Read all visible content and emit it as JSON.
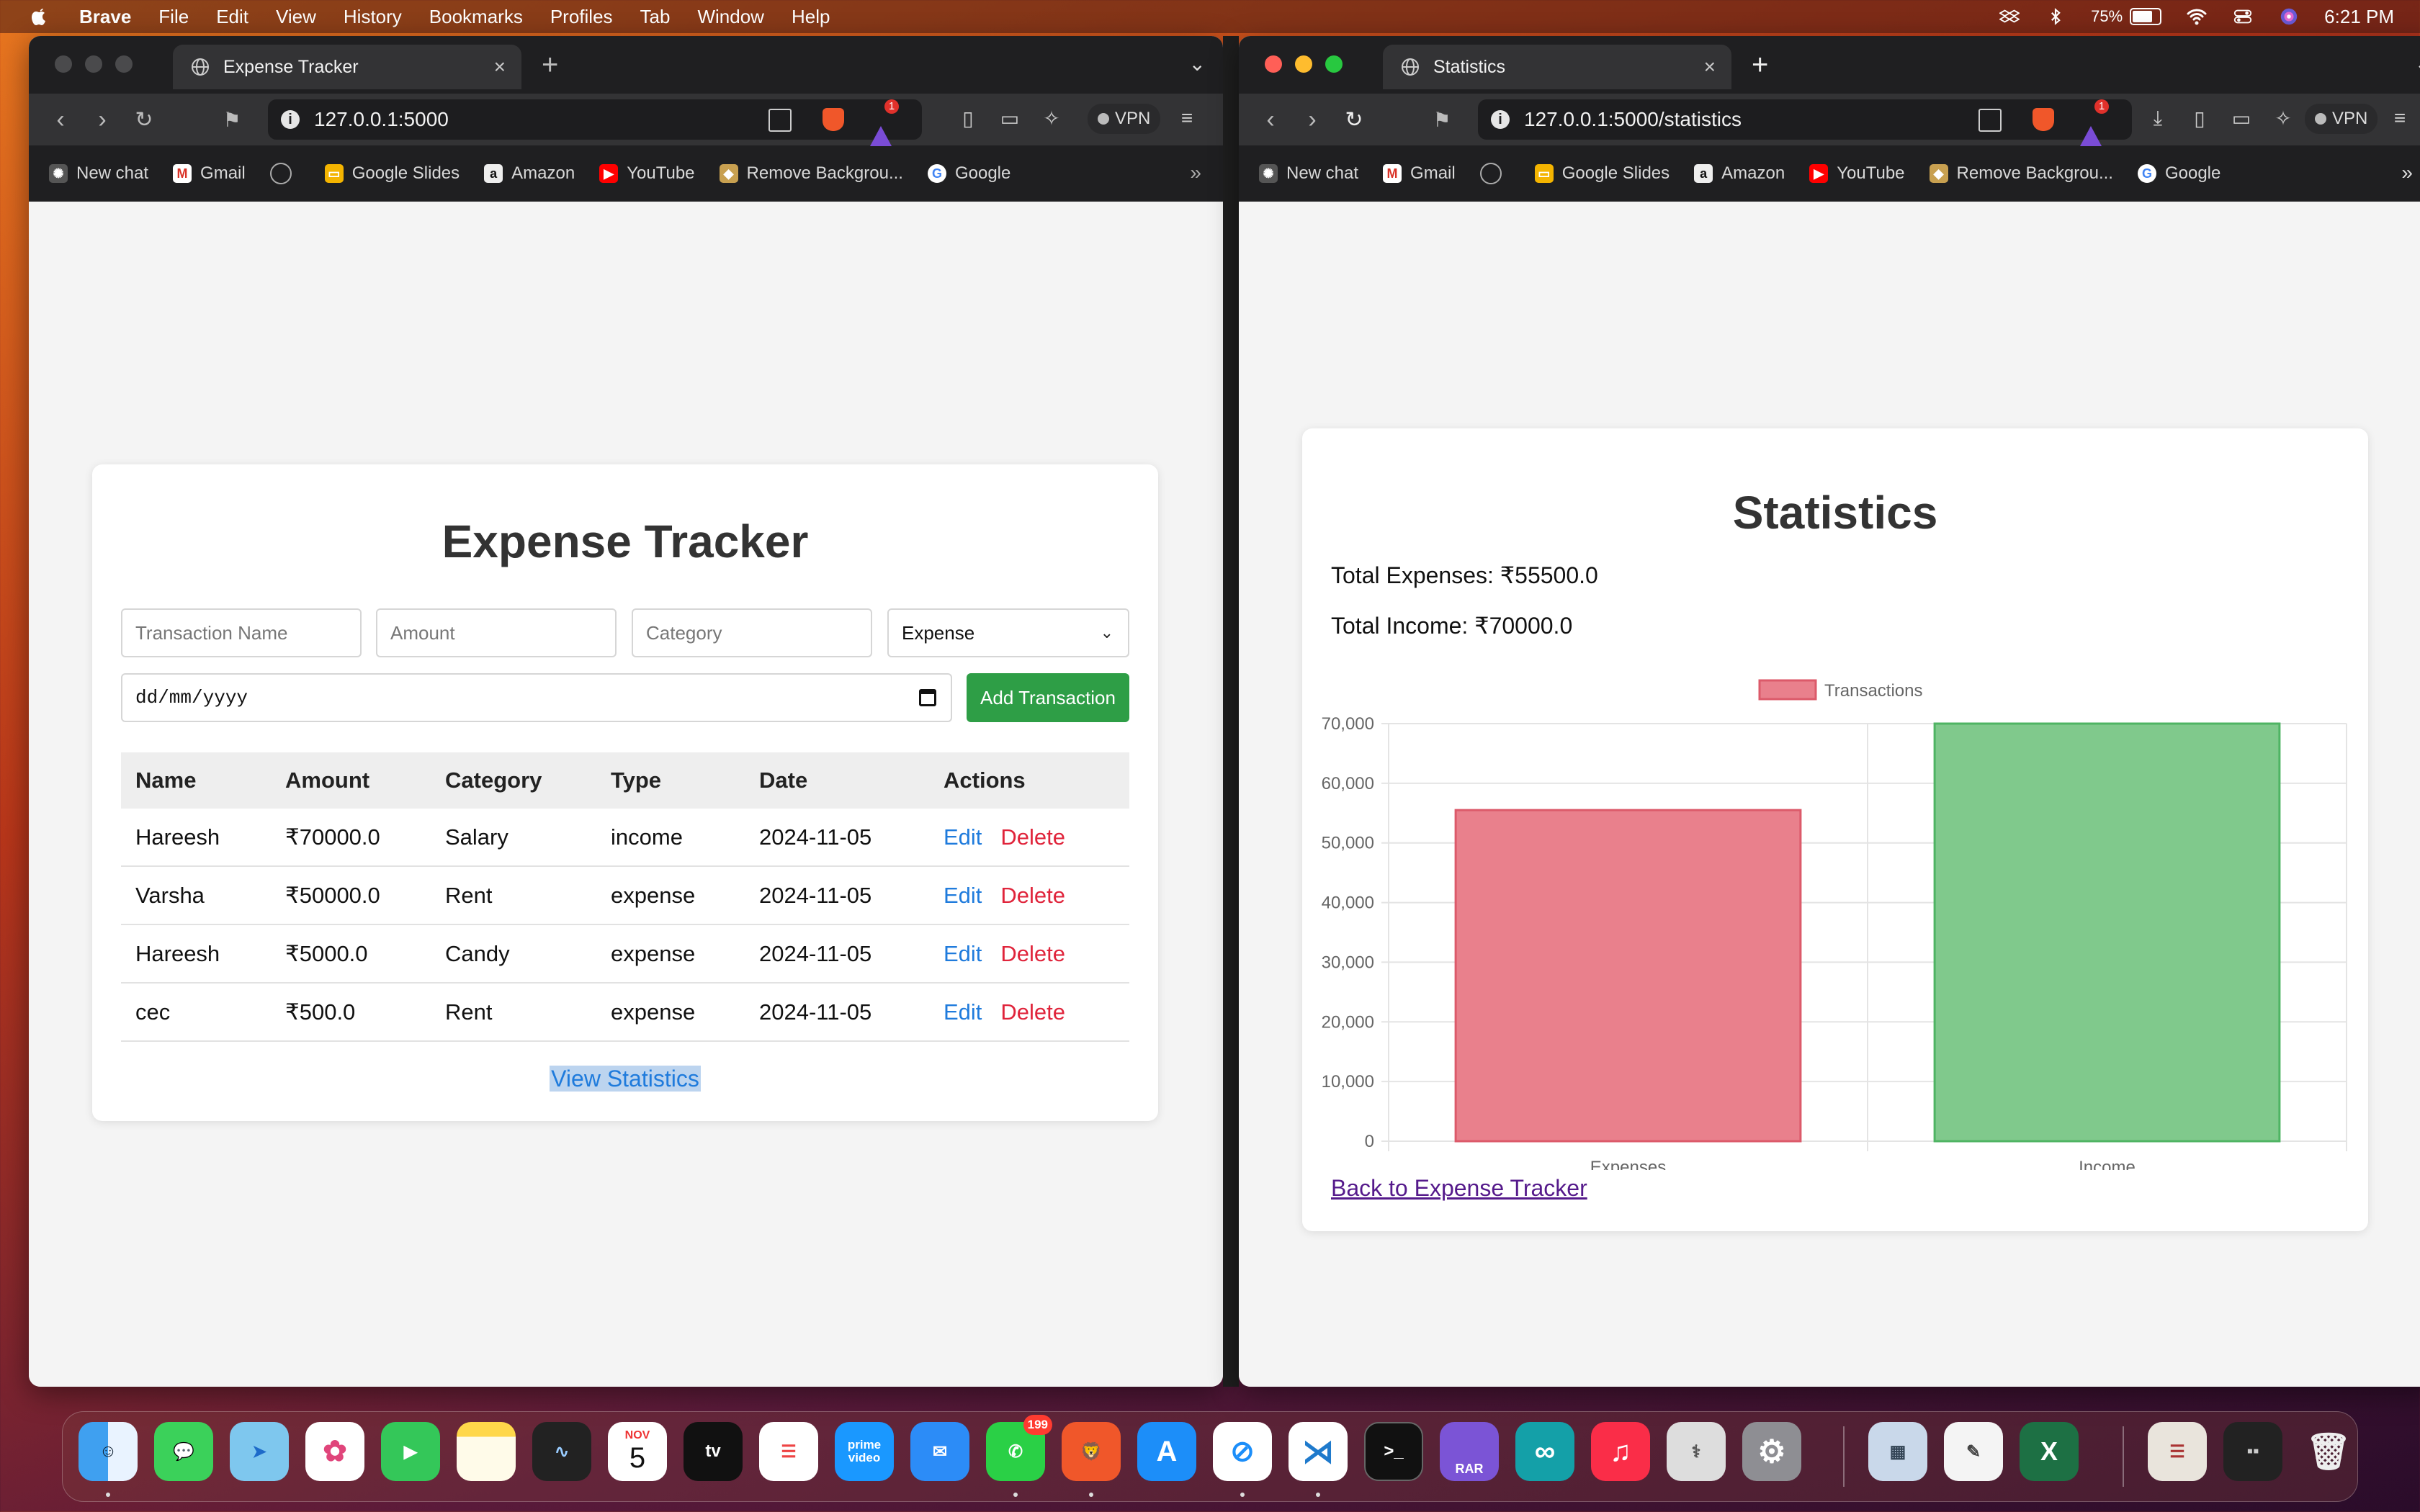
{
  "menubar": {
    "app": "Brave",
    "items": [
      "File",
      "Edit",
      "View",
      "History",
      "Bookmarks",
      "Profiles",
      "Tab",
      "Window",
      "Help"
    ],
    "battery": "75%",
    "battery_level": 0.75,
    "time": "6:21 PM"
  },
  "left_window": {
    "tab_title": "Expense Tracker",
    "url": "127.0.0.1:5000",
    "vpn": "VPN"
  },
  "right_window": {
    "tab_title": "Statistics",
    "url": "127.0.0.1:5000/statistics",
    "vpn": "VPN"
  },
  "bookmarks": [
    "New chat",
    "Gmail",
    "",
    "Google Slides",
    "Amazon",
    "YouTube",
    "Remove Backgrou...",
    "Google"
  ],
  "tracker": {
    "title": "Expense Tracker",
    "name_placeholder": "Transaction Name",
    "amount_placeholder": "Amount",
    "category_placeholder": "Category",
    "type_selected": "Expense",
    "date_placeholder": "dd/mm/yyyy",
    "add_button": "Add Transaction",
    "columns": [
      "Name",
      "Amount",
      "Category",
      "Type",
      "Date",
      "Actions"
    ],
    "rows": [
      {
        "name": "Hareesh",
        "amount": "₹70000.0",
        "category": "Salary",
        "type": "income",
        "date": "2024-11-05"
      },
      {
        "name": "Varsha",
        "amount": "₹50000.0",
        "category": "Rent",
        "type": "expense",
        "date": "2024-11-05"
      },
      {
        "name": "Hareesh",
        "amount": "₹5000.0",
        "category": "Candy",
        "type": "expense",
        "date": "2024-11-05"
      },
      {
        "name": "cec",
        "amount": "₹500.0",
        "category": "Rent",
        "type": "expense",
        "date": "2024-11-05"
      }
    ],
    "edit_label": "Edit",
    "delete_label": "Delete",
    "view_stats": "View Statistics"
  },
  "stats": {
    "title": "Statistics",
    "total_expenses": "Total Expenses: ₹55500.0",
    "total_income": "Total Income: ₹70000.0",
    "back_link": "Back to Expense Tracker"
  },
  "chart_data": {
    "type": "bar",
    "categories": [
      "Expenses",
      "Income"
    ],
    "series": [
      {
        "name": "Transactions",
        "values": [
          55500,
          70000
        ]
      }
    ],
    "colors": [
      "#e9808c",
      "#80c98c"
    ],
    "border_colors": [
      "#dc5a6a",
      "#4fb463"
    ],
    "yticks": [
      "0",
      "10,000",
      "20,000",
      "30,000",
      "40,000",
      "50,000",
      "60,000",
      "70,000"
    ],
    "ylim": [
      0,
      70000
    ],
    "legend": "top-center",
    "grid": true
  },
  "dock": {
    "calendar_month": "NOV",
    "calendar_day": "5",
    "whatsapp_badge": "199",
    "tv_label": "tv",
    "prime_label": "prime video",
    "rar_label": "RAR"
  }
}
